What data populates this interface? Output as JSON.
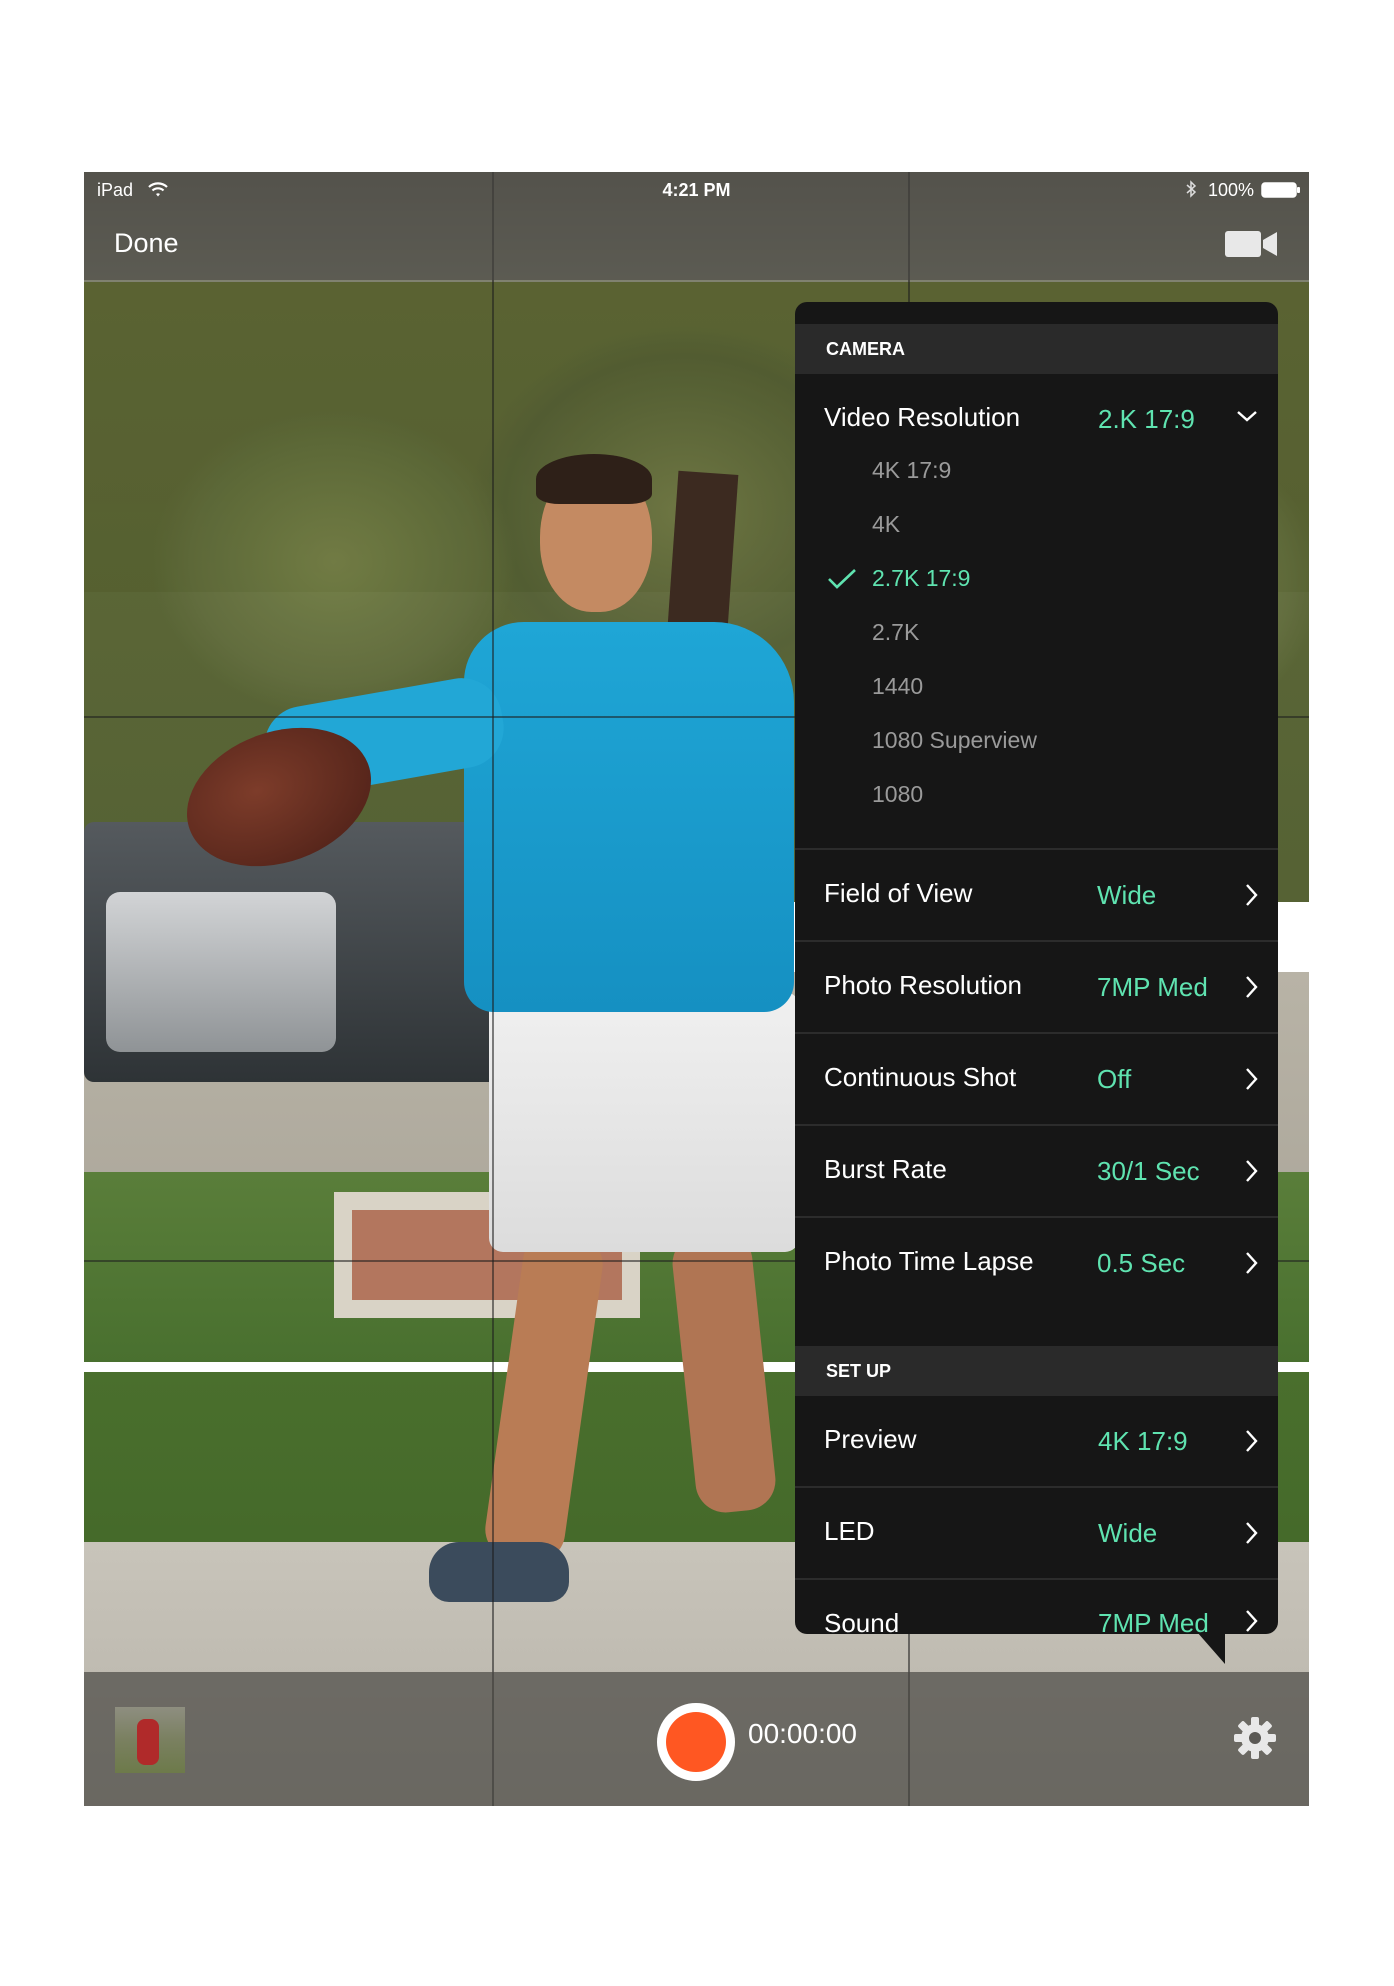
{
  "status_bar": {
    "carrier": "iPad",
    "time": "4:21 PM",
    "battery": "100%"
  },
  "nav": {
    "done_label": "Done",
    "camera_mode_icon": "video-camera-icon"
  },
  "bottom_bar": {
    "timecode": "00:00:00",
    "record_color": "#ff5722"
  },
  "settings": {
    "accent_color": "#5fe3b0",
    "camera_section_title": "CAMERA",
    "video_resolution": {
      "label": "Video Resolution",
      "value": "2.K 17:9",
      "options": [
        "4K 17:9",
        "4K",
        "2.7K 17:9",
        "2.7K",
        "1440",
        "1080 Superview",
        "1080"
      ],
      "selected": "2.7K 17:9"
    },
    "camera_rows": [
      {
        "label": "Field of View",
        "value": "Wide"
      },
      {
        "label": "Photo Resolution",
        "value": "7MP Med"
      },
      {
        "label": "Continuous Shot",
        "value": "Off"
      },
      {
        "label": "Burst Rate",
        "value": "30/1 Sec"
      },
      {
        "label": "Photo Time Lapse",
        "value": "0.5 Sec"
      }
    ],
    "setup_section_title": "SET UP",
    "setup_rows": [
      {
        "label": "Preview",
        "value": "4K 17:9"
      },
      {
        "label": "LED",
        "value": "Wide"
      },
      {
        "label": "Sound",
        "value": "7MP Med"
      }
    ]
  }
}
